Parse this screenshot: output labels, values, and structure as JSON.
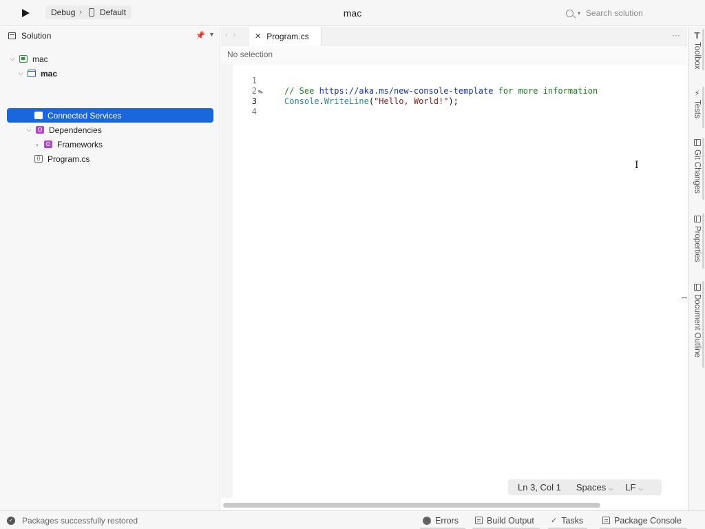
{
  "toolbar": {
    "configuration": "Debug",
    "separator": "›",
    "target": "Default",
    "window_title": "mac",
    "search_placeholder": "Search solution"
  },
  "solution_pane": {
    "title": "Solution",
    "items": [
      {
        "label": "mac",
        "kind": "solution"
      },
      {
        "label": "mac",
        "kind": "project"
      },
      {
        "label": "Connected Services",
        "kind": "connected-services",
        "selected": true
      },
      {
        "label": "Dependencies",
        "kind": "dependencies"
      },
      {
        "label": "Frameworks",
        "kind": "frameworks"
      },
      {
        "label": "Program.cs",
        "kind": "file"
      }
    ]
  },
  "editor": {
    "tab_label": "Program.cs",
    "breadcrumb": "No selection",
    "line_numbers": [
      "1",
      "2",
      "3",
      "4"
    ],
    "line1": {
      "comment_prefix": "// See ",
      "link": "https://aka.ms/new-console-template",
      "comment_suffix": " for more information"
    },
    "line2": {
      "type": "Console",
      "dot": ".",
      "method": "WriteLine",
      "open": "(",
      "string": "\"Hello, World!\"",
      "close": ");"
    },
    "status": {
      "position": "Ln 3, Col 1",
      "indentation": "Spaces",
      "line_endings": "LF"
    }
  },
  "side_dock": {
    "items": [
      "Toolbox",
      "Tests",
      "Git Changes",
      "Properties",
      "Document Outline"
    ]
  },
  "status_bar": {
    "message": "Packages successfully restored",
    "pads": [
      "Errors",
      "Build Output",
      "Tasks",
      "Package Console"
    ]
  },
  "colors": {
    "selection": "#1a66dd",
    "comment": "#1c7d1c",
    "link": "#1633b8",
    "type": "#2b8a9a",
    "string": "#8a1a1a"
  }
}
